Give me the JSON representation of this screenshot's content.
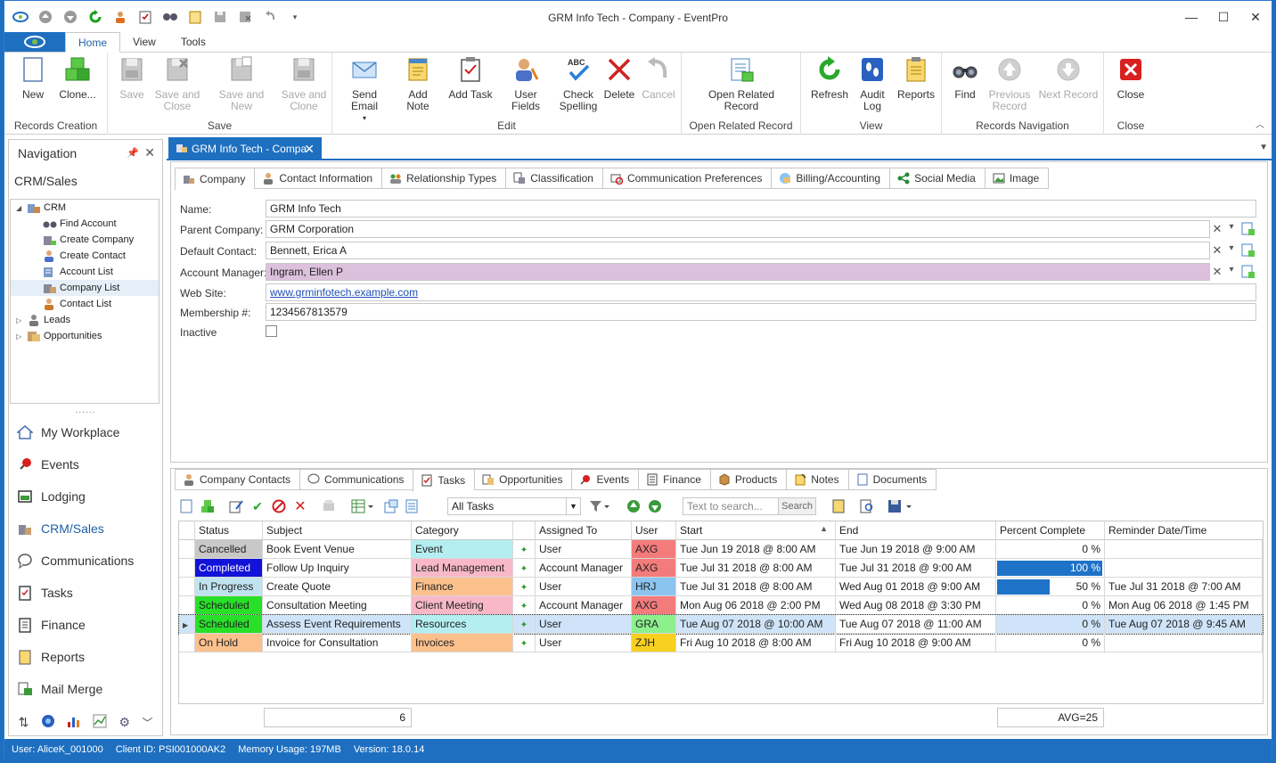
{
  "window": {
    "title": "GRM Info Tech - Company - EventPro"
  },
  "menu": {
    "tabs": [
      "Home",
      "View",
      "Tools"
    ]
  },
  "ribbon": {
    "groups": {
      "records_creation": "Records Creation",
      "save": "Save",
      "edit": "Edit",
      "open_related": "Open Related Record",
      "view": "View",
      "records_navigation": "Records Navigation",
      "close": "Close"
    },
    "buttons": {
      "new": "New",
      "clone": "Clone...",
      "save": "Save",
      "save_and_close": "Save and Close",
      "save_and_new": "Save and New",
      "save_and_clone": "Save and Clone",
      "send_email": "Send Email",
      "add_note": "Add Note",
      "add_task": "Add Task",
      "user_fields": "User Fields",
      "check_spelling": "Check Spelling",
      "delete": "Delete",
      "cancel": "Cancel",
      "open_related_record": "Open Related Record",
      "refresh": "Refresh",
      "audit_log": "Audit Log",
      "reports": "Reports",
      "find": "Find",
      "previous_record": "Previous Record",
      "next_record": "Next Record",
      "close": "Close"
    },
    "icon_names": {
      "abc_label": "ABC"
    }
  },
  "nav": {
    "title": "Navigation",
    "section": "CRM/Sales",
    "tree": {
      "crm": "CRM",
      "find_account": "Find Account",
      "create_company": "Create Company",
      "create_contact": "Create Contact",
      "account_list": "Account List",
      "company_list": "Company List",
      "contact_list": "Contact List",
      "leads": "Leads",
      "opportunities": "Opportunities"
    },
    "grip": "......",
    "modules": {
      "my_workplace": "My Workplace",
      "events": "Events",
      "lodging": "Lodging",
      "crm_sales": "CRM/Sales",
      "communications": "Communications",
      "tasks": "Tasks",
      "finance": "Finance",
      "reports": "Reports",
      "mail_merge": "Mail Merge"
    }
  },
  "doc_tab": {
    "label": "GRM Info Tech - Compa"
  },
  "detail_tabs": {
    "company": "Company",
    "contact_info": "Contact Information",
    "relationship_types": "Relationship Types",
    "classification": "Classification",
    "comm_prefs": "Communication Preferences",
    "billing": "Billing/Accounting",
    "social_media": "Social Media",
    "image": "Image"
  },
  "form": {
    "name_label": "Name:",
    "name": "GRM Info Tech",
    "parent_label": "Parent Company:",
    "parent": "GRM Corporation",
    "contact_label": "Default Contact:",
    "contact": "Bennett, Erica A",
    "manager_label": "Account Manager:",
    "manager": "Ingram, Ellen P",
    "website_label": "Web Site:",
    "website": "www.grminfotech.example.com",
    "membership_label": "Membership #:",
    "membership": "1234567813579",
    "inactive_label": "Inactive",
    "inactive": false
  },
  "bottom_tabs": {
    "company_contacts": "Company Contacts",
    "communications": "Communications",
    "tasks": "Tasks",
    "opportunities": "Opportunities",
    "events": "Events",
    "finance": "Finance",
    "products": "Products",
    "notes": "Notes",
    "documents": "Documents"
  },
  "grid_toolbar": {
    "filter_value": "All Tasks",
    "search_placeholder": "Text to search...",
    "search_button": "Search"
  },
  "grid": {
    "columns": {
      "status": "Status",
      "subject": "Subject",
      "category": "Category",
      "assigned": "Assigned To",
      "user": "User",
      "start": "Start",
      "end": "End",
      "percent": "Percent Complete",
      "reminder": "Reminder Date/Time"
    },
    "rows": [
      {
        "status": "Cancelled",
        "status_color": "#c8c8c8",
        "status_fg": "#222222",
        "subject": "Book Event Venue",
        "category": "Event",
        "category_color": "#b4eef0",
        "assigned": "User",
        "user": "AXG",
        "user_color": "#f47b7b",
        "start": "Tue Jun 19 2018 @ 8:00 AM",
        "end": "Tue Jun 19 2018 @ 9:00 AM",
        "percent": 0,
        "percent_text": "0 %",
        "reminder": ""
      },
      {
        "status": "Completed",
        "status_color": "#1212d8",
        "status_fg": "#ffffff",
        "subject": "Follow Up Inquiry",
        "category": "Lead Management",
        "category_color": "#f8b8c8",
        "assigned": "Account Manager",
        "user": "AXG",
        "user_color": "#f47b7b",
        "start": "Tue Jul 31 2018 @ 8:00 AM",
        "end": "Tue Jul 31 2018 @ 9:00 AM",
        "percent": 100,
        "percent_text": "100 %",
        "reminder": ""
      },
      {
        "status": "In Progress",
        "status_color": "#bfe3f0",
        "status_fg": "#222222",
        "subject": "Create Quote",
        "category": "Finance",
        "category_color": "#fcc08c",
        "assigned": "User",
        "user": "HRJ",
        "user_color": "#8cc4f0",
        "start": "Tue Jul 31 2018 @ 8:00 AM",
        "end": "Wed Aug 01 2018 @ 9:00 AM",
        "percent": 50,
        "percent_text": "50 %",
        "reminder": "Tue Jul 31 2018 @ 7:00 AM"
      },
      {
        "status": "Scheduled",
        "status_color": "#28e028",
        "status_fg": "#222222",
        "subject": "Consultation Meeting",
        "category": "Client Meeting",
        "category_color": "#f8b8c8",
        "assigned": "Account Manager",
        "user": "AXG",
        "user_color": "#f47b7b",
        "start": "Mon Aug 06 2018 @ 2:00 PM",
        "end": "Wed Aug 08 2018 @ 3:30 PM",
        "percent": 0,
        "percent_text": "0 %",
        "reminder": "Mon Aug 06 2018 @ 1:45 PM"
      },
      {
        "status": "Scheduled",
        "status_color": "#28e028",
        "status_fg": "#222222",
        "subject": "Assess Event Requirements",
        "category": "Resources",
        "category_color": "#b4eef0",
        "assigned": "User",
        "user": "GRA",
        "user_color": "#8cf08c",
        "start": "Tue Aug 07 2018 @ 10:00 AM",
        "end": "Tue Aug 07 2018 @ 11:00 AM",
        "percent": 0,
        "percent_text": "0 %",
        "reminder": "Tue Aug 07 2018 @ 9:45 AM"
      },
      {
        "status": "On Hold",
        "status_color": "#fcc08c",
        "status_fg": "#222222",
        "subject": "Invoice for Consultation",
        "category": "Invoices",
        "category_color": "#fcc08c",
        "assigned": "User",
        "user": "ZJH",
        "user_color": "#f8d020",
        "start": "Fri Aug 10 2018 @ 8:00 AM",
        "end": "Fri Aug 10 2018 @ 9:00 AM",
        "percent": 0,
        "percent_text": "0 %",
        "reminder": ""
      }
    ],
    "footer": {
      "count": "6",
      "avg": "AVG=25"
    }
  },
  "status_bar": {
    "user": "User: AliceK_001000",
    "client": "Client ID: PSI001000AK2",
    "memory": "Memory Usage: 197MB",
    "version": "Version: 18.0.14"
  }
}
